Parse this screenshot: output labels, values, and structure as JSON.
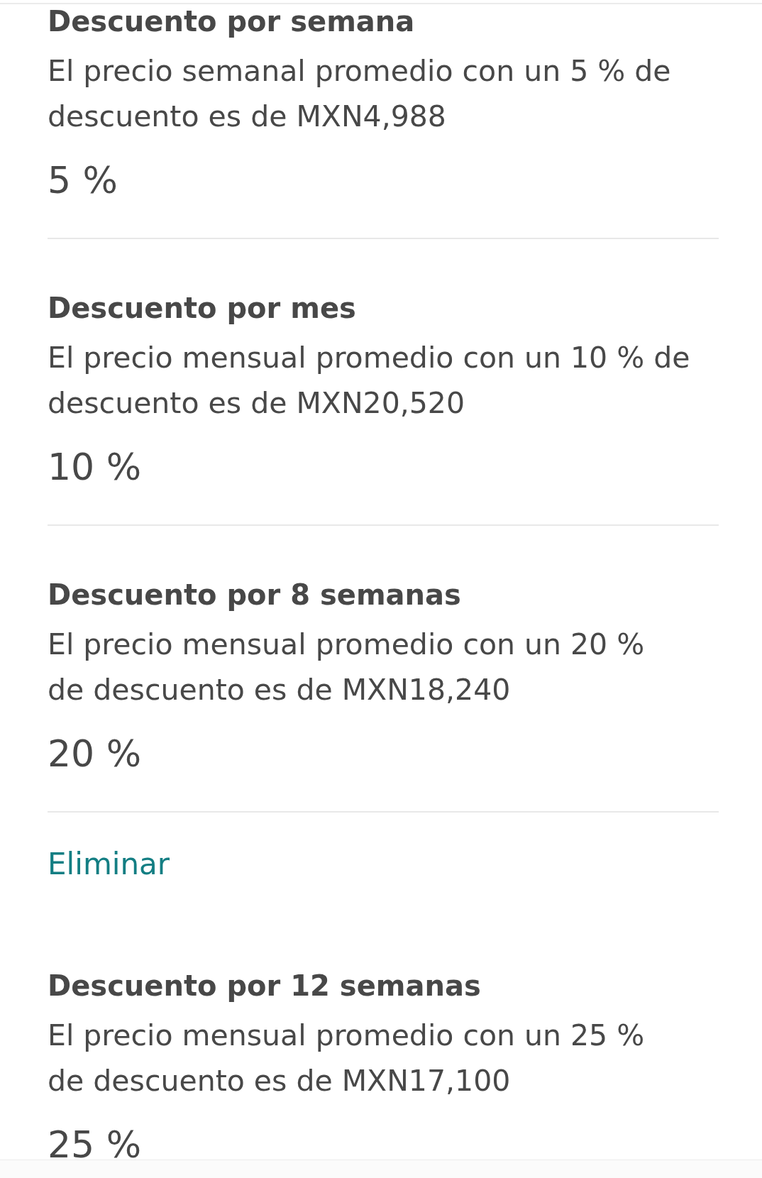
{
  "items": [
    {
      "kind": "discount",
      "title": "Descuento por semana",
      "description": "El precio semanal promedio con un 5 % de\ndescuento es de MXN4,988",
      "value": "5 %"
    },
    {
      "kind": "discount",
      "title": "Descuento por mes",
      "description": "El precio mensual promedio con un 10 % de\ndescuento es de MXN20,520",
      "value": "10 %"
    },
    {
      "kind": "discount",
      "title": "Descuento por 8 semanas",
      "description": "El precio mensual promedio con un 20 %\nde descuento es de MXN18,240",
      "value": "20 %"
    },
    {
      "kind": "link",
      "label": "Eliminar"
    },
    {
      "kind": "discount",
      "title": "Descuento por 12 semanas",
      "description": "El precio mensual promedio con un 25 %\nde descuento es de MXN17,100",
      "value": "25 %"
    }
  ]
}
